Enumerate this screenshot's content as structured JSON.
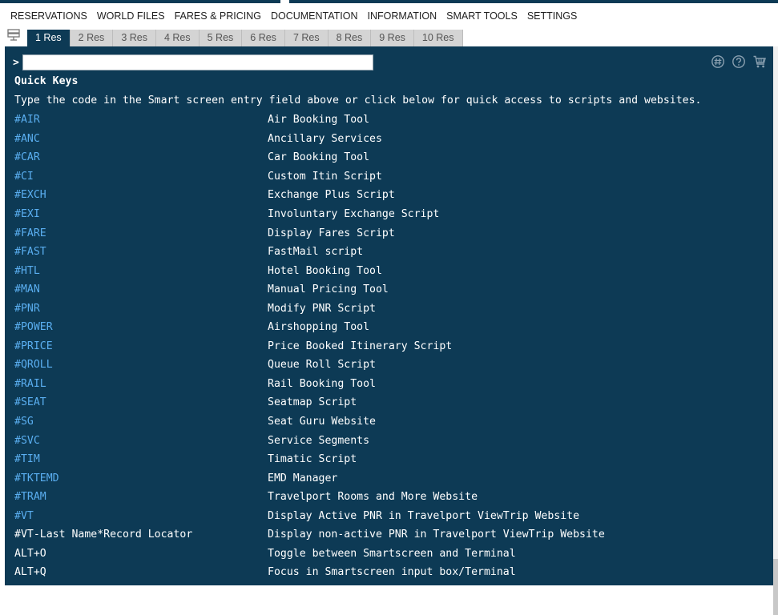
{
  "menu": {
    "items": [
      "RESERVATIONS",
      "WORLD FILES",
      "FARES & PRICING",
      "DOCUMENTATION",
      "INFORMATION",
      "SMART TOOLS",
      "SETTINGS"
    ]
  },
  "tabs": {
    "items": [
      "1 Res",
      "2 Res",
      "3 Res",
      "4 Res",
      "5 Res",
      "6 Res",
      "7 Res",
      "8 Res",
      "9 Res",
      "10 Res"
    ],
    "active_index": 0
  },
  "terminal": {
    "prompt": ">",
    "input_value": "",
    "title": "Quick Keys",
    "description": "Type the code in the Smart screen entry field above or click below for quick access to scripts and websites.",
    "rows": [
      {
        "code": "#AIR",
        "label": "Air Booking Tool",
        "link": true
      },
      {
        "code": "#ANC",
        "label": "Ancillary Services",
        "link": true
      },
      {
        "code": "#CAR",
        "label": "Car Booking Tool",
        "link": true
      },
      {
        "code": "#CI",
        "label": "Custom Itin Script",
        "link": true
      },
      {
        "code": "#EXCH",
        "label": "Exchange Plus Script",
        "link": true
      },
      {
        "code": "#EXI",
        "label": "Involuntary Exchange Script",
        "link": true
      },
      {
        "code": "#FARE",
        "label": "Display Fares Script",
        "link": true
      },
      {
        "code": "#FAST",
        "label": "FastMail script",
        "link": true
      },
      {
        "code": "#HTL",
        "label": "Hotel Booking Tool",
        "link": true
      },
      {
        "code": "#MAN",
        "label": "Manual Pricing Tool",
        "link": true
      },
      {
        "code": "#PNR",
        "label": "Modify PNR Script",
        "link": true
      },
      {
        "code": "#POWER",
        "label": "Airshopping Tool",
        "link": true
      },
      {
        "code": "#PRICE",
        "label": "Price Booked Itinerary Script",
        "link": true
      },
      {
        "code": "#QROLL",
        "label": "Queue Roll Script",
        "link": true
      },
      {
        "code": "#RAIL",
        "label": "Rail Booking Tool",
        "link": true
      },
      {
        "code": "#SEAT",
        "label": "Seatmap Script",
        "link": true
      },
      {
        "code": "#SG",
        "label": "Seat Guru Website",
        "link": true
      },
      {
        "code": "#SVC",
        "label": "Service Segments",
        "link": true
      },
      {
        "code": "#TIM",
        "label": "Timatic Script",
        "link": true
      },
      {
        "code": "#TKTEMD",
        "label": "EMD Manager",
        "link": true
      },
      {
        "code": "#TRAM",
        "label": "Travelport Rooms and More Website",
        "link": true
      },
      {
        "code": "#VT",
        "label": "Display Active PNR in Travelport ViewTrip Website",
        "link": true
      },
      {
        "code": "#VT-Last Name*Record Locator",
        "label": "Display non-active PNR in Travelport ViewTrip Website",
        "link": false
      },
      {
        "code": "ALT+O",
        "label": "Toggle between Smartscreen and Terminal",
        "link": false
      },
      {
        "code": "ALT+Q",
        "label": "Focus in Smartscreen input box/Terminal",
        "link": false
      }
    ]
  },
  "icons": {
    "top_right": [
      "hash-icon",
      "help-icon",
      "cart-icon"
    ],
    "tab_left": "terminal-icon"
  },
  "colors": {
    "terminal_bg": "#0d3a55",
    "link": "#5aaef0",
    "tab_inactive": "#d4d4d4"
  }
}
